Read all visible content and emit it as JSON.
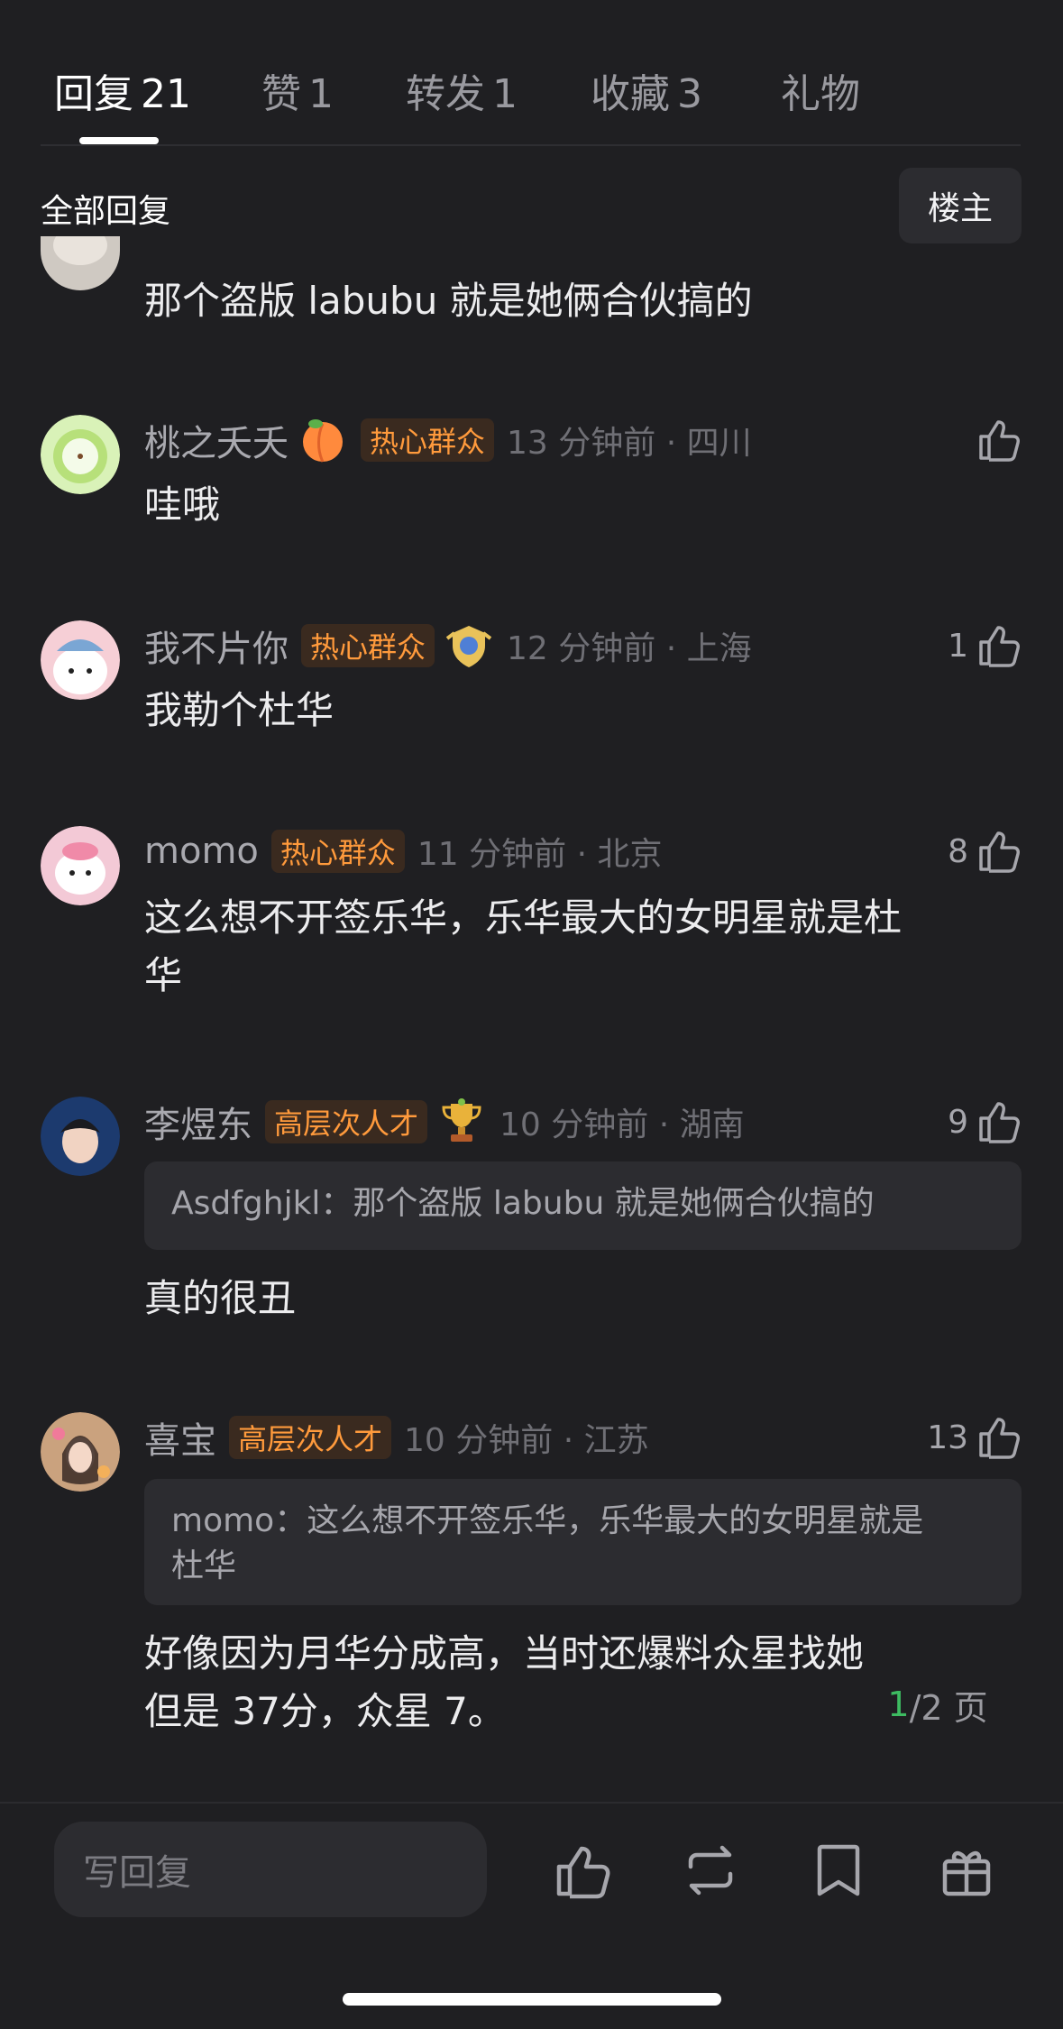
{
  "tabs": [
    {
      "label": "回复",
      "count": "21"
    },
    {
      "label": "赞",
      "count": "1"
    },
    {
      "label": "转发",
      "count": "1"
    },
    {
      "label": "收藏",
      "count": "3"
    },
    {
      "label": "礼物",
      "count": ""
    }
  ],
  "filter": {
    "all_label": "全部回复",
    "owner_button": "楼主"
  },
  "comments": [
    {
      "text": "那个盗版 labubu 就是她俩合伙搞的"
    },
    {
      "name": "桃之夭夭",
      "badge": "热心群众",
      "time": "13 分钟前 · 四川",
      "likes": "",
      "text": "哇哦",
      "emoji": "peach-icon"
    },
    {
      "name": "我不片你",
      "badge": "热心群众",
      "time": "12 分钟前 · 上海",
      "likes": "1",
      "text": "我勒个杜华",
      "emoji": "shield-medal-icon"
    },
    {
      "name": "momo",
      "badge": "热心群众",
      "time": "11 分钟前 · 北京",
      "likes": "8",
      "text_line1": "这么想不开签乐华，乐华最大的女明星就是杜",
      "text_line2": "华"
    },
    {
      "name": "李煜东",
      "badge": "高层次人才",
      "time": "10 分钟前 · 湖南",
      "likes": "9",
      "quote": "Asdfghjkl：那个盗版 labubu 就是她俩合伙搞的",
      "text": "真的很丑",
      "emoji": "trophy-icon"
    },
    {
      "name": "喜宝",
      "badge": "高层次人才",
      "time": "10 分钟前 · 江苏",
      "likes": "13",
      "quote_line1": "momo：这么想不开签乐华，乐华最大的女明星就是",
      "quote_line2": "杜华",
      "text_line1": "好像因为月华分成高，当时还爆料众星找她",
      "text_line2": "但是 37分，众星 7。"
    }
  ],
  "pager": {
    "current": "1",
    "rest": "/2 页"
  },
  "bottom_bar": {
    "reply_placeholder": "写回复"
  },
  "colors": {
    "background": "#1f1f22",
    "badge_text": "#ff9a3c",
    "pager_current": "#3dbb61"
  }
}
